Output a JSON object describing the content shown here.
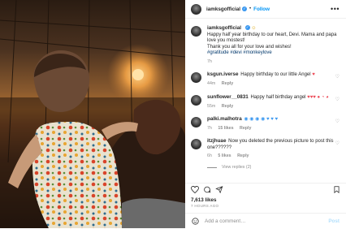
{
  "post": {
    "username": "iamksgofficial",
    "follow_label": "Follow",
    "more_label": "•••",
    "caption": {
      "username": "iamksgofficial",
      "text_line1": "Happy half year birthday to our heart, Devi. Mama and papa love you mostest!",
      "text_line2": "Thank you all for your love and wishes!",
      "hashtags": "#gratitude #devi #monkeylove",
      "time": "7h"
    },
    "comments": [
      {
        "username": "ksgun.iverse",
        "text": "Happy birthday to our little Angel",
        "emoji": "♥",
        "time": "44m",
        "reply": "Reply"
      },
      {
        "username": "sunflower__0831",
        "text": "Happy half birthday angel",
        "emoji": "♥♥♥ ● ◔ ◕",
        "time": "55m",
        "reply": "Reply"
      },
      {
        "username": "palki.malhotra",
        "text": "",
        "emoji": "◉ ◉ ◉ ◉ ♥ ♥ ♥",
        "time": "7h",
        "likes": "15 likes",
        "reply": "Reply"
      },
      {
        "username": "itzjhuae",
        "text": "Now you deleted the previous picture to post this one??????",
        "emoji": "",
        "time": "6h",
        "likes": "5 likes",
        "reply": "Reply"
      }
    ],
    "view_replies": "View replies (2)",
    "likes_count": "7,613 likes",
    "time_ago": "7 HOURS AGO",
    "add_comment_placeholder": "Add a comment…",
    "post_label": "Post"
  },
  "colors": {
    "accent": "#0095f6",
    "verified": "#3897f0",
    "heart": "#ed4956"
  }
}
